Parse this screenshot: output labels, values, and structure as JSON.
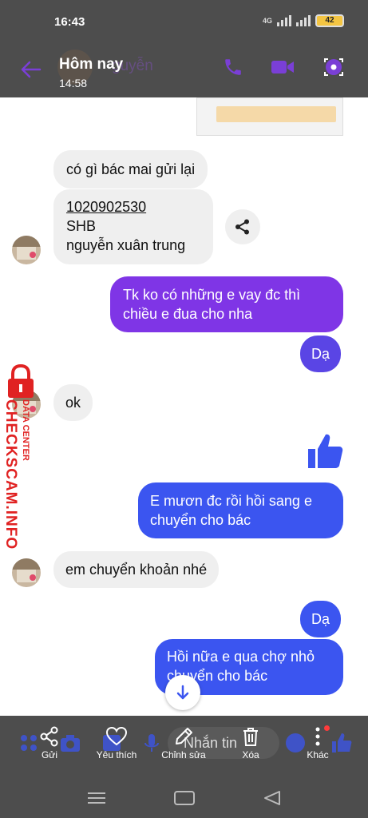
{
  "status_bar": {
    "time": "16:43",
    "time_ghost": "8",
    "network": "4G",
    "battery": "42"
  },
  "header": {
    "title": "Hôm nay",
    "title_ghost": "guyễn",
    "subtitle": "14:58"
  },
  "messages": [
    {
      "side": "in",
      "text": "có gì bác mai gửi  lại"
    },
    {
      "side": "in",
      "lines": [
        "1020902530",
        "SHB",
        "nguyễn xuân trung"
      ]
    },
    {
      "side": "out",
      "lines": [
        "Tk ko có những e vay đc thì",
        "chiều e đua cho nha"
      ]
    },
    {
      "side": "out",
      "text": "Dạ"
    },
    {
      "side": "in",
      "text": "ok"
    },
    {
      "side": "out",
      "lines": [
        "E mươn đc rồi hồi sang e",
        "chuyển cho bác"
      ]
    },
    {
      "side": "in",
      "text": "em chuyển khoản nhé"
    },
    {
      "side": "out",
      "text": "Dạ"
    },
    {
      "side": "out",
      "lines": [
        "Hồi nữa e qua chợ nhỏ",
        "chuyển cho bác"
      ]
    }
  ],
  "watermark": {
    "brand": "CHECKSCAM.INFO",
    "sub": "DATA CENTER"
  },
  "composer": {
    "placeholder": "Nhắn tin"
  },
  "actions": [
    {
      "label": "Gửi",
      "icon": "share-icon"
    },
    {
      "label": "Yêu thích",
      "icon": "heart-icon"
    },
    {
      "label": "Chỉnh sửa",
      "icon": "pencil-icon"
    },
    {
      "label": "Xóa",
      "icon": "trash-icon"
    },
    {
      "label": "Khác",
      "icon": "more-icon"
    }
  ],
  "colors": {
    "overlay": "#4d4d4d",
    "accent_purple": "#7f35e6",
    "accent_blue": "#3b55f0",
    "incoming": "#efefef"
  }
}
